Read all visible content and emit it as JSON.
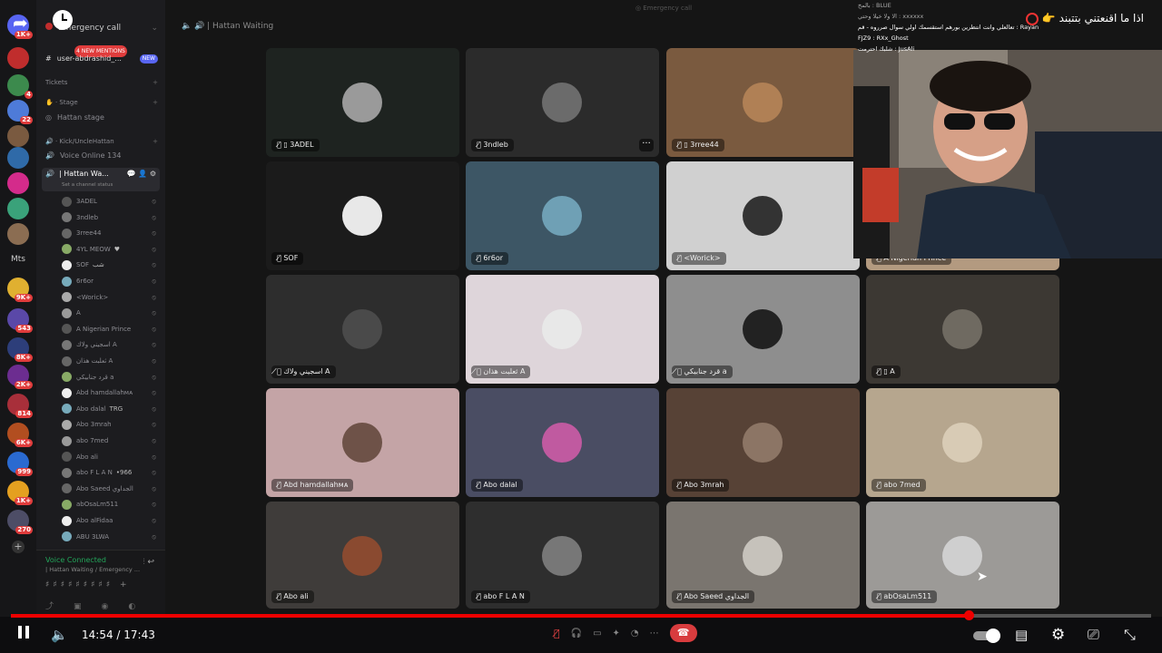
{
  "chat_overlay": {
    "lines": [
      "بالمخ : BLUE",
      "الا ولا خيلا وحتي : xxxxxx",
      "تعالعلي وانت انتظرين بورهم استقسمك اولي سوال صرروه - قم : Rayan",
      "FJZ9 : RXx_Ghost",
      "شلبك احترمت : JusAli"
    ]
  },
  "stream_overlay": {
    "text": "اذا ما اقنعتني بتتبند"
  },
  "call": {
    "top_title": "Emergency call",
    "voice_title": "| Hattan Waiting"
  },
  "sidebar": {
    "server_title": "Emergency call",
    "mentions_badge": "4 NEW MENTIONS",
    "new_badge": "NEW",
    "channel_user": "user-abdrashid_...",
    "tickets_label": "Tickets",
    "stage_group": "Stage",
    "stage_channel": "Hattan stage",
    "kick_group": "Kick/UncleHattan",
    "voice_online": "Voice Online 134",
    "active_voice": "| Hattan Wa...",
    "channel_status": "Set a channel status",
    "members": [
      "3ADEL",
      "3ndleb",
      "3rree44",
      "4YL MEOW",
      "SOF",
      "6r6or",
      "<Worick>",
      "A",
      "A Nigerian Prince",
      "اسجيني ولاك A",
      "ثعلبت هذان A",
      "قرد جنابيكي a",
      "Abd hamdallahᴍᴀ",
      "Abo dalal",
      "Abo 3mrah",
      "abo 7med",
      "Abo ali",
      "abo F L A N",
      "Abo Saeed الجداوي",
      "abOsaLm511",
      "Abo alFidaa",
      "ABU 3LWA"
    ],
    "member_tags": {
      "4YL MEOW": "♥",
      "SOF": "شب",
      "Abo dalal": "TRG",
      "abo F L A N": "•966"
    },
    "voice_connected": "Voice Connected",
    "voice_channel_path": "| Hattan Waiting / Emergency ...",
    "guild_labels": {
      "mts": "Mts"
    },
    "guild_badges": [
      "1K+",
      "4",
      "22",
      "9K+",
      "543",
      "8K+",
      "2K+",
      "814",
      "6K+",
      "999",
      "1K+",
      "270"
    ]
  },
  "tiles": [
    {
      "name": "3ADEL",
      "bg": "#1e2320",
      "av": "#9a9a9a",
      "phone": true
    },
    {
      "name": "3ndleb",
      "bg": "#2b2b2b",
      "av": "#6b6b6b",
      "more": "···"
    },
    {
      "name": "3rree44",
      "bg": "#7a5a3f",
      "av": "#b08055",
      "phone": true
    },
    {
      "name": "SOF",
      "bg": "#1b1b1b",
      "av": "#e8e8e8"
    },
    {
      "name": "6r6or",
      "bg": "#3d5665",
      "av": "#6fa0b5"
    },
    {
      "name": "<Worick>",
      "bg": "#d0d0d0",
      "av": "#333"
    },
    {
      "name": "A Nigerian Prince",
      "bg": "#b39a80",
      "av": "#a58463"
    },
    {
      "name": "اسجيني ولاك A",
      "bg": "#2d2d2d",
      "av": "#4a4a4a"
    },
    {
      "name": "ثعلبت هذان A",
      "bg": "#ded5da",
      "av": "#e8e8e8"
    },
    {
      "name": "قرد جنابيكي a",
      "bg": "#8e8e8e",
      "av": "#222"
    },
    {
      "name": "A",
      "bg": "#3c3833",
      "av": "#6f6a61",
      "phone": true
    },
    {
      "name": "Abd hamdallahᴍᴀ",
      "bg": "#c4a4a6",
      "av": "#6e5248"
    },
    {
      "name": "Abo dalal",
      "bg": "#4a4d63",
      "av": "#c05aa0"
    },
    {
      "name": "Abo 3mrah",
      "bg": "#574236",
      "av": "#8c7565"
    },
    {
      "name": "abo 7med",
      "bg": "#b6a68e",
      "av": "#d8cbb5"
    },
    {
      "name": "Abo ali",
      "bg": "#3f3c3a",
      "av": "#8a4a30"
    },
    {
      "name": "abo F L A N",
      "bg": "#2e2e2e",
      "av": "#777"
    },
    {
      "name": "Abo Saeed الجداوي",
      "bg": "#7a756f",
      "av": "#c6c2bb"
    },
    {
      "name": "abOsaLm511",
      "bg": "#9c9a97",
      "av": "#cfcfcf"
    }
  ],
  "player": {
    "time_current": "14:54",
    "time_total": "17:43",
    "progress": 0.84,
    "time_sep": " / "
  },
  "colors": {
    "accent": "#e00000",
    "discord_green": "#23a55a",
    "badge_red": "#e03c3c",
    "hangup": "#d83c3e"
  },
  "icons": [
    "share-icon",
    "clock-icon",
    "pause-icon",
    "volume-icon",
    "autoplay-toggle-icon",
    "subtitles-icon",
    "settings-icon",
    "cast-icon",
    "exit-fullscreen-icon",
    "mic-muted-icon",
    "deafen-icon",
    "camera-icon",
    "screen-share-icon",
    "activity-icon",
    "soundboard-icon",
    "more-icon",
    "hangup-icon",
    "cursor-icon"
  ]
}
